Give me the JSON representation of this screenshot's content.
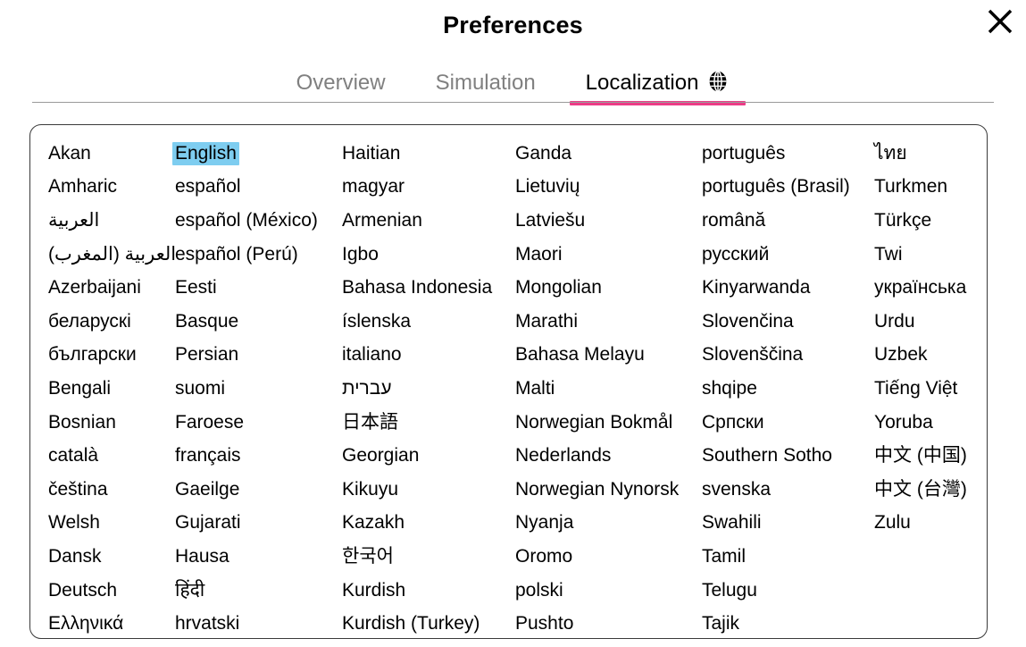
{
  "dialog": {
    "title": "Preferences",
    "close_icon": "close-icon"
  },
  "tabs": [
    {
      "label": "Overview",
      "active": false,
      "icon": null
    },
    {
      "label": "Simulation",
      "active": false,
      "icon": null
    },
    {
      "label": "Localization",
      "active": true,
      "icon": "globe-icon"
    }
  ],
  "colors": {
    "active_tab_underline": "#ec3c87",
    "selection_highlight": "#7ecdf0",
    "inactive_tab_text": "#808080",
    "active_tab_text": "#000000",
    "panel_border": "#3a3a3a"
  },
  "language_list": {
    "selected": "English",
    "columns": [
      {
        "items": [
          {
            "label": "Akan",
            "rtl": false
          },
          {
            "label": "Amharic",
            "rtl": false
          },
          {
            "label": "العربية",
            "rtl": true
          },
          {
            "label": "العربية (المغرب)",
            "rtl": true
          },
          {
            "label": "Azerbaijani",
            "rtl": false
          },
          {
            "label": "беларускі",
            "rtl": false
          },
          {
            "label": "български",
            "rtl": false
          },
          {
            "label": "Bengali",
            "rtl": false
          },
          {
            "label": "Bosnian",
            "rtl": false
          },
          {
            "label": "català",
            "rtl": false
          },
          {
            "label": "čeština",
            "rtl": false
          },
          {
            "label": "Welsh",
            "rtl": false
          },
          {
            "label": "Dansk",
            "rtl": false
          },
          {
            "label": "Deutsch",
            "rtl": false
          },
          {
            "label": "Ελληνικά",
            "rtl": false
          }
        ]
      },
      {
        "items": [
          {
            "label": "English",
            "rtl": false
          },
          {
            "label": "español",
            "rtl": false
          },
          {
            "label": "español (México)",
            "rtl": false
          },
          {
            "label": "español (Perú)",
            "rtl": false
          },
          {
            "label": "Eesti",
            "rtl": false
          },
          {
            "label": "Basque",
            "rtl": false
          },
          {
            "label": "Persian",
            "rtl": false
          },
          {
            "label": "suomi",
            "rtl": false
          },
          {
            "label": "Faroese",
            "rtl": false
          },
          {
            "label": "français",
            "rtl": false
          },
          {
            "label": "Gaeilge",
            "rtl": false
          },
          {
            "label": "Gujarati",
            "rtl": false
          },
          {
            "label": "Hausa",
            "rtl": false
          },
          {
            "label": "हिंदी",
            "rtl": false
          },
          {
            "label": "hrvatski",
            "rtl": false
          }
        ]
      },
      {
        "items": [
          {
            "label": "Haitian",
            "rtl": false
          },
          {
            "label": "magyar",
            "rtl": false
          },
          {
            "label": "Armenian",
            "rtl": false
          },
          {
            "label": "Igbo",
            "rtl": false
          },
          {
            "label": "Bahasa Indonesia",
            "rtl": false
          },
          {
            "label": "íslenska",
            "rtl": false
          },
          {
            "label": "italiano",
            "rtl": false
          },
          {
            "label": "עברית",
            "rtl": false
          },
          {
            "label": "日本語",
            "rtl": false
          },
          {
            "label": "Georgian",
            "rtl": false
          },
          {
            "label": "Kikuyu",
            "rtl": false
          },
          {
            "label": "Kazakh",
            "rtl": false
          },
          {
            "label": "한국어",
            "rtl": false
          },
          {
            "label": "Kurdish",
            "rtl": false
          },
          {
            "label": "Kurdish (Turkey)",
            "rtl": false
          }
        ]
      },
      {
        "items": [
          {
            "label": "Ganda",
            "rtl": false
          },
          {
            "label": "Lietuvių",
            "rtl": false
          },
          {
            "label": "Latviešu",
            "rtl": false
          },
          {
            "label": "Maori",
            "rtl": false
          },
          {
            "label": "Mongolian",
            "rtl": false
          },
          {
            "label": "Marathi",
            "rtl": false
          },
          {
            "label": "Bahasa Melayu",
            "rtl": false
          },
          {
            "label": "Malti",
            "rtl": false
          },
          {
            "label": "Norwegian Bokmål",
            "rtl": false
          },
          {
            "label": "Nederlands",
            "rtl": false
          },
          {
            "label": "Norwegian Nynorsk",
            "rtl": false
          },
          {
            "label": "Nyanja",
            "rtl": false
          },
          {
            "label": "Oromo",
            "rtl": false
          },
          {
            "label": "polski",
            "rtl": false
          },
          {
            "label": "Pushto",
            "rtl": false
          }
        ]
      },
      {
        "items": [
          {
            "label": "português",
            "rtl": false
          },
          {
            "label": "português (Brasil)",
            "rtl": false
          },
          {
            "label": "română",
            "rtl": false
          },
          {
            "label": "русский",
            "rtl": false
          },
          {
            "label": "Kinyarwanda",
            "rtl": false
          },
          {
            "label": "Slovenčina",
            "rtl": false
          },
          {
            "label": "Slovenščina",
            "rtl": false
          },
          {
            "label": "shqipe",
            "rtl": false
          },
          {
            "label": "Српски",
            "rtl": false
          },
          {
            "label": "Southern Sotho",
            "rtl": false
          },
          {
            "label": "svenska",
            "rtl": false
          },
          {
            "label": "Swahili",
            "rtl": false
          },
          {
            "label": "Tamil",
            "rtl": false
          },
          {
            "label": "Telugu",
            "rtl": false
          },
          {
            "label": "Tajik",
            "rtl": false
          }
        ]
      },
      {
        "items": [
          {
            "label": "ไทย",
            "rtl": false
          },
          {
            "label": "Turkmen",
            "rtl": false
          },
          {
            "label": "Türkçe",
            "rtl": false
          },
          {
            "label": "Twi",
            "rtl": false
          },
          {
            "label": "українська",
            "rtl": false
          },
          {
            "label": "Urdu",
            "rtl": false
          },
          {
            "label": "Uzbek",
            "rtl": false
          },
          {
            "label": "Tiếng Việt",
            "rtl": false
          },
          {
            "label": "Yoruba",
            "rtl": false
          },
          {
            "label": "中文 (中国)",
            "rtl": false
          },
          {
            "label": "中文 (台灣)",
            "rtl": false
          },
          {
            "label": "Zulu",
            "rtl": false
          }
        ]
      }
    ]
  }
}
